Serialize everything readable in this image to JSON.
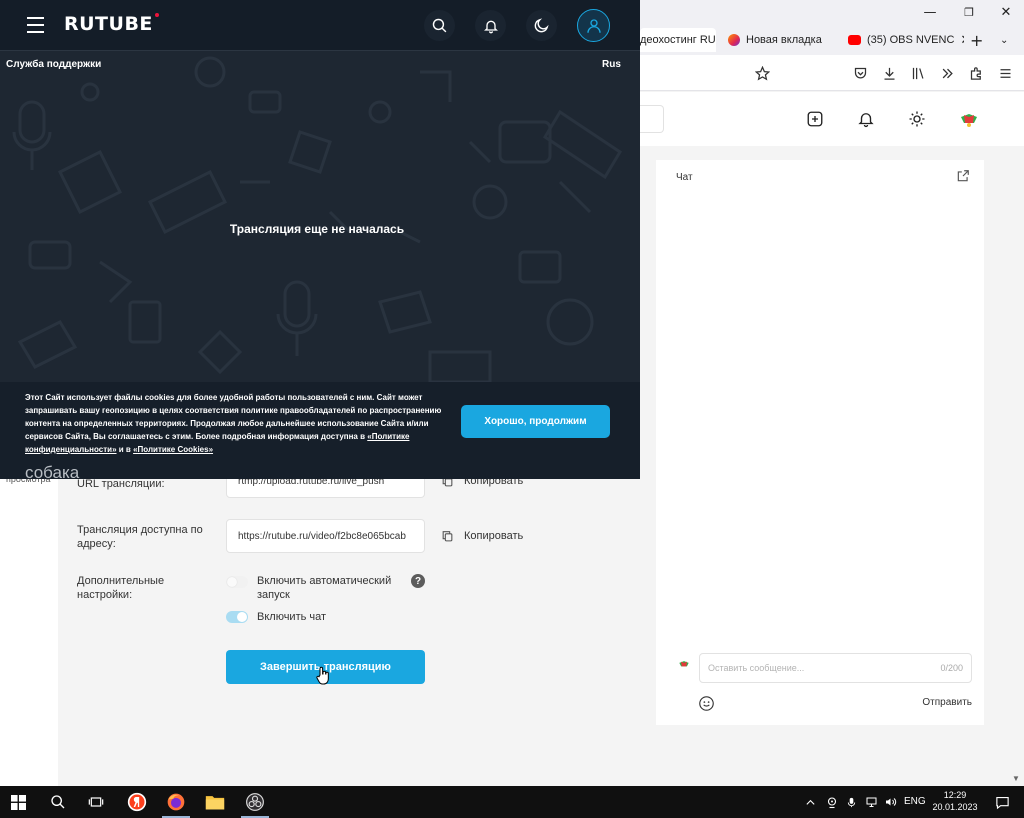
{
  "browser": {
    "tabs": [
      {
        "label": "деохостинг RU",
        "active": true
      },
      {
        "label": "Новая вкладка",
        "active": false
      },
      {
        "label": "(35) OBS NVENC",
        "active": false
      }
    ]
  },
  "player": {
    "logo": "RUTUBE",
    "support_label": "Служба поддержки",
    "lang_label": "Rus",
    "status": "Трансляция еще не началась",
    "cookie": {
      "text": "Этот Сайт использует файлы cookies для более удобной работы пользователей с ним. Сайт может запрашивать вашу геопозицию в целях соответствия политике правообладателей по распространению контента на определенных территориях. Продолжая любое дальнейшее использование Сайта и/или сервисов Сайта, Вы соглашаетесь с этим. Более подробная информация доступна в",
      "privacy_link": "«Политике конфиденциальности»",
      "and": "и в",
      "cookies_link": "«Политике Cookies»",
      "accept_label": "Хорошо, продолжим"
    },
    "overlay_text": "собака"
  },
  "studio": {
    "left_label": "просмотра",
    "url_label": "URL трансляции:",
    "url_value": "rtmp://upload.rutube.ru/live_push",
    "address_label": "Трансляция доступна по адресу:",
    "address_value": "https://rutube.ru/video/f2bc8e065bcab",
    "copy_label": "Копировать",
    "extra_label": "Дополнительные настройки:",
    "auto_start_label": "Включить автоматический запуск",
    "auto_start_on": false,
    "chat_toggle_label": "Включить чат",
    "chat_toggle_on": true,
    "help_glyph": "?",
    "end_button_label": "Завершить трансляцию",
    "accent_color": "#1aa7e0"
  },
  "chat": {
    "title": "Чат",
    "placeholder": "Оставить сообщение...",
    "counter": "0/200",
    "send_label": "Отправить"
  },
  "taskbar": {
    "lang": "ENG",
    "time": "12:29",
    "date": "20.01.2023"
  }
}
